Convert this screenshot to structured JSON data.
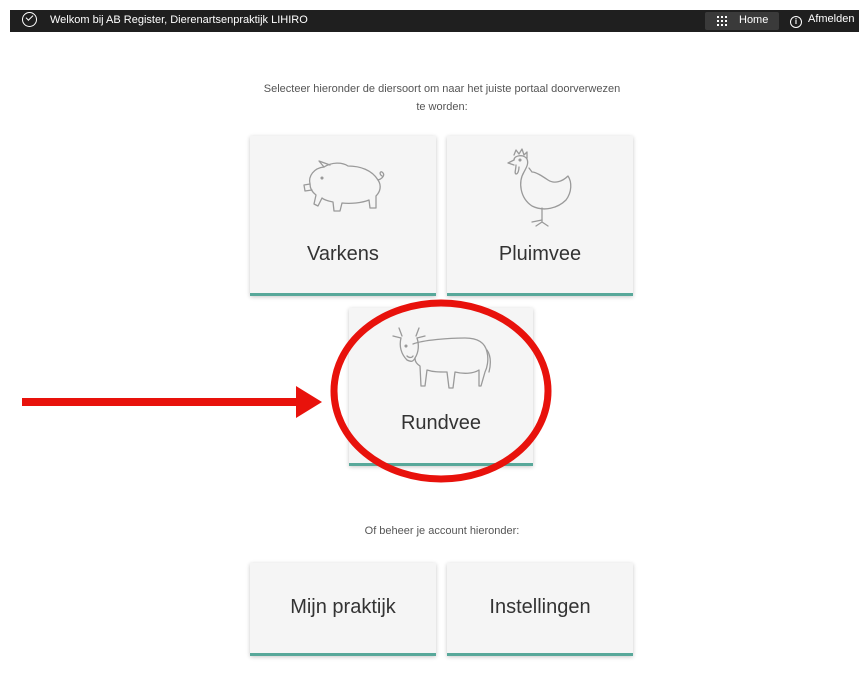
{
  "topbar": {
    "welcome": "Welkom bij AB Register, Dierenartsenpraktijk LIHIRO",
    "home_label": "Home",
    "logout_label": "Afmelden"
  },
  "intro": {
    "line1": "Selecteer hieronder de diersoort om naar het juiste portaal doorverwezen",
    "line2": "te worden:"
  },
  "animals": {
    "varkens": "Varkens",
    "pluimvee": "Pluimvee",
    "rundvee": "Rundvee"
  },
  "account": {
    "subtitle": "Of beheer je account hieronder:",
    "mijn_praktijk": "Mijn praktijk",
    "instellingen": "Instellingen"
  },
  "colors": {
    "topbar": "#1f1f1f",
    "tile_background": "#f5f5f5",
    "tile_accent": "#58a89a",
    "annotation": "#e8120c"
  }
}
